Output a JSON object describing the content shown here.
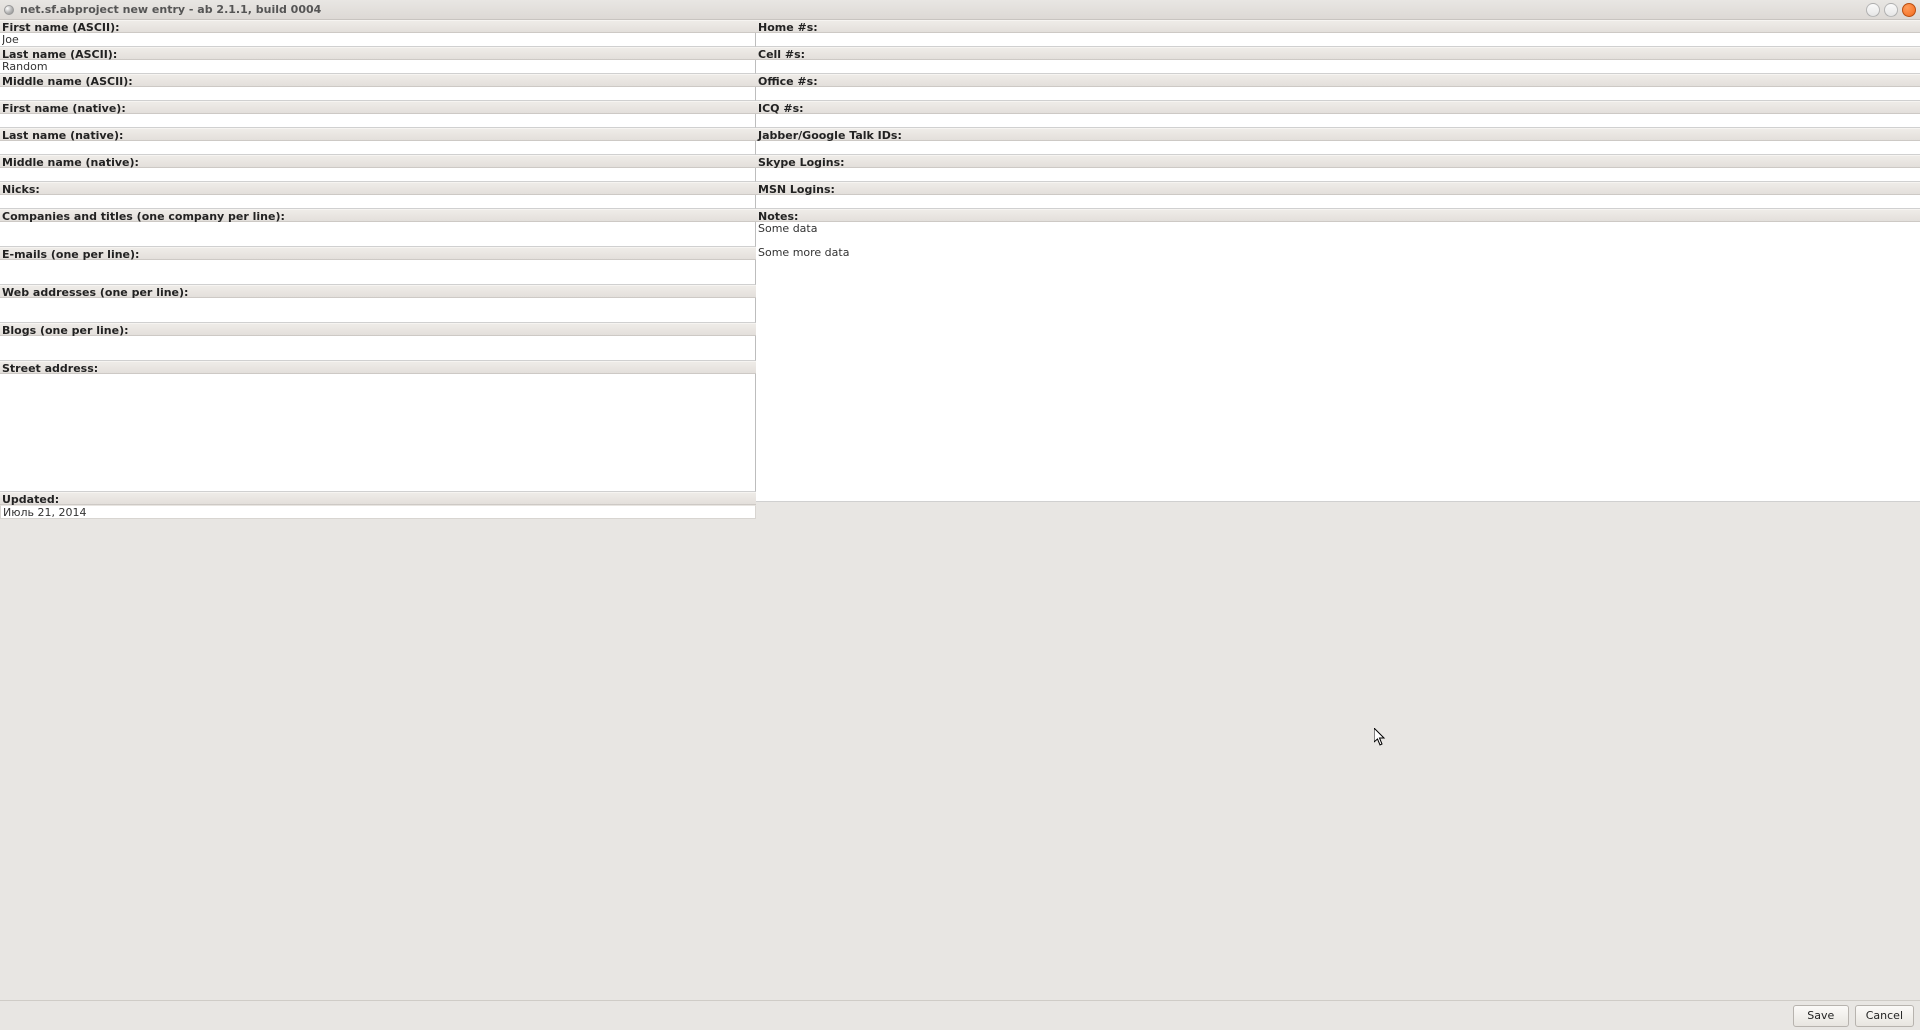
{
  "window": {
    "title": "net.sf.abproject new entry - ab 2.1.1, build 0004"
  },
  "left": {
    "first_name_ascii": {
      "label": "First name (ASCII):",
      "value": "Joe"
    },
    "last_name_ascii": {
      "label": "Last name (ASCII):",
      "value": "Random"
    },
    "middle_name_ascii": {
      "label": "Middle name (ASCII):",
      "value": ""
    },
    "first_name_native": {
      "label": "First name (native):",
      "value": ""
    },
    "last_name_native": {
      "label": "Last name (native):",
      "value": ""
    },
    "middle_name_native": {
      "label": "Middle name (native):",
      "value": ""
    },
    "nicks": {
      "label": "Nicks:",
      "value": ""
    },
    "companies": {
      "label": "Companies and titles (one company per line):",
      "value": ""
    },
    "emails": {
      "label": "E-mails (one per line):",
      "value": ""
    },
    "web": {
      "label": "Web addresses (one per line):",
      "value": ""
    },
    "blogs": {
      "label": "Blogs (one per line):",
      "value": ""
    },
    "street": {
      "label": "Street address:",
      "value": ""
    },
    "updated": {
      "label": "Updated:",
      "value": "Июль 21, 2014"
    }
  },
  "right": {
    "home": {
      "label": "Home #s:",
      "value": ""
    },
    "cell": {
      "label": "Cell #s:",
      "value": ""
    },
    "office": {
      "label": "Office #s:",
      "value": ""
    },
    "icq": {
      "label": "ICQ #s:",
      "value": ""
    },
    "jabber": {
      "label": "Jabber/Google Talk IDs:",
      "value": ""
    },
    "skype": {
      "label": "Skype Logins:",
      "value": ""
    },
    "msn": {
      "label": "MSN Logins:",
      "value": ""
    },
    "notes": {
      "label": "Notes:",
      "value": "Some data\n\nSome more data"
    }
  },
  "buttons": {
    "save": "Save",
    "cancel": "Cancel"
  }
}
